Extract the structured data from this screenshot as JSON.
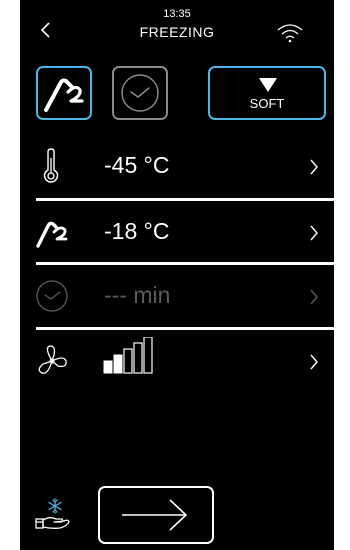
{
  "status_bar": {
    "time": "13:35",
    "mode_title": "FREEZING"
  },
  "icons": {
    "back": "chevron-left-icon",
    "wifi": "wifi-icon",
    "probe": "core-probe-icon",
    "timer": "clock-icon",
    "temperature": "thermometer-icon",
    "fan": "fan-icon",
    "hand": "hand-snowflake-icon",
    "next": "arrow-right-icon"
  },
  "mode_buttons": {
    "probe_selected": true,
    "timer_selected": false,
    "soft_label": "SOFT"
  },
  "rows": {
    "chamber_temp": "-45 °C",
    "probe_temp": "-18 °C",
    "time": "--- min",
    "fan_level": 2,
    "fan_level_max": 5
  },
  "colors": {
    "background": "#000000",
    "accent": "#4cb6e6",
    "inactive": "#8a8a8a",
    "disabled_text": "#5a5a5a",
    "text": "#ffffff"
  }
}
